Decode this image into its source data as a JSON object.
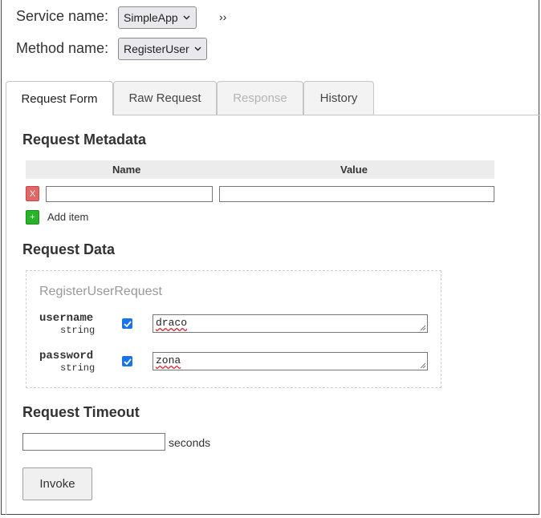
{
  "service": {
    "label": "Service name:",
    "selected": "SimpleApp"
  },
  "method": {
    "label": "Method name:",
    "selected": "RegisterUser"
  },
  "expand_glyph": "››",
  "tabs": [
    {
      "label": "Request Form",
      "active": true,
      "disabled": false
    },
    {
      "label": "Raw Request",
      "active": false,
      "disabled": false
    },
    {
      "label": "Response",
      "active": false,
      "disabled": true
    },
    {
      "label": "History",
      "active": false,
      "disabled": false
    }
  ],
  "metadata": {
    "heading": "Request Metadata",
    "columns": [
      "Name",
      "Value"
    ],
    "rows": [
      {
        "name": "",
        "value": ""
      }
    ],
    "remove_label": "X",
    "add_icon": "+",
    "add_label": "Add item"
  },
  "request_data": {
    "heading": "Request Data",
    "message_name": "RegisterUserRequest",
    "fields": [
      {
        "name": "username",
        "type": "string",
        "checked": true,
        "value": "draco"
      },
      {
        "name": "password",
        "type": "string",
        "checked": true,
        "value": "zona"
      }
    ]
  },
  "timeout": {
    "heading": "Request Timeout",
    "value": "",
    "unit_label": "seconds"
  },
  "invoke_label": "Invoke",
  "colors": {
    "checkbox": "#1a73e8",
    "remove": "#e46767",
    "add": "#27b527"
  }
}
